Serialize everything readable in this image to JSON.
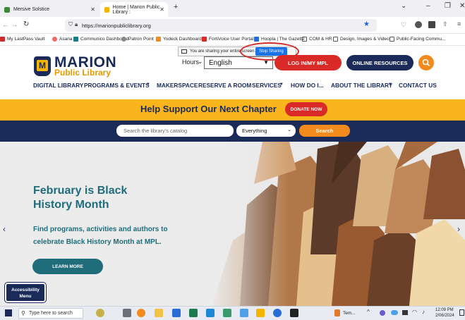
{
  "browser": {
    "tabs": [
      {
        "label": "Mersive Solstice",
        "favicon_color": "#3c8b3a"
      },
      {
        "label": "Home | Marion Public Library :",
        "favicon_color": "#f4b400"
      }
    ],
    "url": "https://marionpubliclibrary.org",
    "bookmarks": [
      "My LastPass Vault",
      "Asana",
      "Communico Dashboard",
      "Patron Point",
      "Yodeck Dashboard",
      "FortiVoice User Portal",
      "Hoopla | The Gazette",
      "COM & HR",
      "Design, Images & Video",
      "Public-Facing Commu..."
    ],
    "share_banner": {
      "message": "You are sharing your entire screen.",
      "stop_label": "Stop Sharing"
    }
  },
  "site": {
    "logo_title": "MARION",
    "logo_subtitle": "Public Library",
    "hours_label": "Hours",
    "language": "English",
    "login_label": "LOG IN/MY MPL",
    "online_label": "ONLINE RESOURCES",
    "nav": [
      "DIGITAL LIBRARY",
      "PROGRAMS & EVENTS",
      "MAKERSPACE",
      "RESERVE A ROOM",
      "SERVICES",
      "HOW DO I...",
      "ABOUT THE LIBRARY",
      "CONTACT US"
    ],
    "support_text": "Help Support Our Next Chapter",
    "donate_label": "DONATE NOW",
    "catalog_placeholder": "Search the library's catalog",
    "catalog_scope": "Everything",
    "catalog_button": "Search",
    "hero": {
      "title_line1": "February is Black",
      "title_line2": "History Month",
      "body_line1": "Find programs, activities and authors to",
      "body_line2": "celebrate Black History Month at MPL.",
      "button": "LEARN MORE"
    },
    "accessibility_line1": "Accessibility",
    "accessibility_line2": "Menu"
  },
  "taskbar": {
    "search_placeholder": "Type here to search",
    "weather": "Tem...",
    "time": "12:09 PM",
    "date": "2/06/2024"
  },
  "colors": {
    "navy": "#1b2b59",
    "gold": "#f9b51b",
    "red": "#d92a27",
    "orange": "#f28a1e",
    "teal": "#1f6c7a"
  }
}
